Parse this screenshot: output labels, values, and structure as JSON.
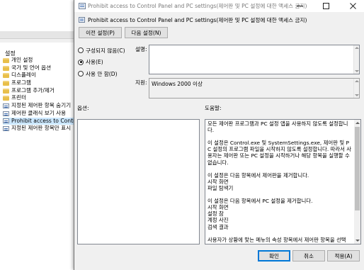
{
  "window": {
    "title": "Prohibit access to Control Panel and PC settings(제어판 및 PC 설정에 대한 액세스 금지)"
  },
  "background": {
    "section_label": "설정",
    "tree_items": [
      {
        "label": "개인 설정",
        "icon": "folder-icon"
      },
      {
        "label": "국가 및 언어 옵션",
        "icon": "folder-icon"
      },
      {
        "label": "디스플레이",
        "icon": "folder-icon"
      },
      {
        "label": "프로그램",
        "icon": "folder-icon"
      },
      {
        "label": "프로그램 추가/제거",
        "icon": "folder-icon"
      },
      {
        "label": "프린터",
        "icon": "folder-icon"
      },
      {
        "label": "지정된 제어판 항목 숨기기",
        "icon": "policy-icon"
      },
      {
        "label": "제어판 클래식 보기 사용",
        "icon": "policy-icon"
      },
      {
        "label": "Prohibit access to Control P",
        "icon": "policy-icon"
      },
      {
        "label": "지정된 제어판 항목만 표시",
        "icon": "policy-icon"
      }
    ]
  },
  "header": {
    "policy_title": "Prohibit access to Control Panel and PC settings(제어판 및 PC 설정에 대한 액세스 금지)"
  },
  "nav": {
    "prev_label": "이전 설정(P)",
    "next_label": "다음 설정(N)"
  },
  "state": {
    "options": [
      "구성되지 않음(C)",
      "사용(E)",
      "사용 안 함(D)"
    ],
    "selected": "사용(E)"
  },
  "labels": {
    "comment": "설명:",
    "supported": "지원:",
    "options": "옵션:",
    "help": "도움말:"
  },
  "supported_on": "Windows 2000 이상",
  "help": {
    "paragraphs": [
      "모든 제어판 프로그램과 PC 설정 앱을 사용하지 않도록 설정합니다.",
      "이 설정은 Control.exe 및 SystemSettings.exe, 제어판 및 PC 설정의 프로그램 파일을 시작하지 않도록 설정합니다. 따라서 사용자는 제어판 또는 PC 설정을 시작하거나 해당 항목을 실행할 수 없습니다.",
      "이 설정은 다음 항목에서 제어판을 제거합니다.\n시작 화면\n파일 탐색기",
      "이 설정은 다음 항목에서 PC 설정을 제거합니다.\n시작 화면\n설정 참\n계정 사진\n검색 결과",
      "사용자가 상황에 맞는 메뉴의 속성 항목에서 제어판 항목을 선택"
    ]
  },
  "footer": {
    "ok_label": "확인",
    "cancel_label": "취소",
    "apply_label": "적용(A)"
  }
}
